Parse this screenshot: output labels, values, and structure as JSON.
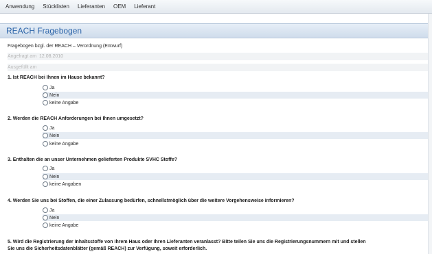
{
  "menu": {
    "items": [
      {
        "label": "Anwendung"
      },
      {
        "label": "Stücklisten"
      },
      {
        "label": "Lieferanten"
      },
      {
        "label": "OEM"
      },
      {
        "label": "Lieferant"
      }
    ]
  },
  "page": {
    "title": "REACH Fragebogen",
    "subtitle": "Fragebogen bzgl. der REACH – Verordnung (Entwurf)"
  },
  "fields": {
    "requested_label": "Angefragt am",
    "requested_value": "12.08.2010",
    "filled_label": "Ausgefüllt am",
    "filled_value": ""
  },
  "questions": [
    {
      "text": "1. Ist REACH bei Ihnen im Hause bekannt?",
      "options": [
        "Ja",
        "Nein",
        "keine Angabe"
      ]
    },
    {
      "text": "2. Werden die REACH Anforderungen bei Ihnen umgesetzt?",
      "options": [
        "Ja",
        "Nein",
        "keine Angabe"
      ]
    },
    {
      "text": "3. Enthalten die an unser Unternehmen gelieferten Produkte SVHC Stoffe?",
      "options": [
        "Ja",
        "Nein",
        "keine Angaben"
      ]
    },
    {
      "text": "4. Werden Sie uns bei Stoffen, die einer Zulassung bedürfen, schnellstmöglich über die weitere Vorgehensweise informieren?",
      "options": [
        "Ja",
        "Nein",
        "keine Angabe"
      ]
    },
    {
      "text": "5. Wird die Registrierung der Inhaltsstoffe von Ihrem Haus oder Ihren Lieferanten veranlasst? Bitte teilen Sie uns die Registrierungsnummern mit und stellen",
      "text2": "Sie uns die Sicherheitsdatenblätter (gemäß REACH) zur Verfügung, soweit erforderlich."
    }
  ]
}
